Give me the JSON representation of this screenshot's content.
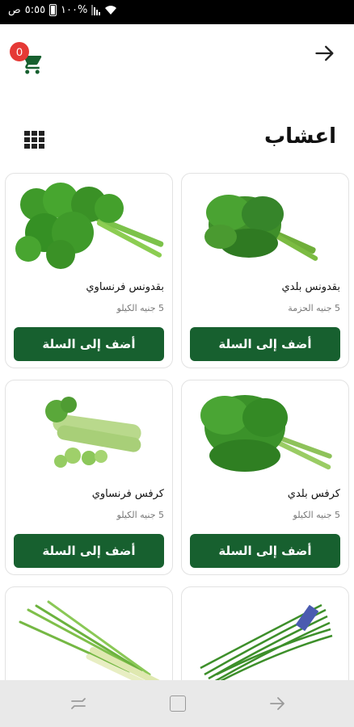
{
  "status_bar": {
    "time": "٥:٥٥",
    "period": "ص",
    "battery_text": "%١٠٠"
  },
  "cart": {
    "count": "0",
    "icon": "shopping-cart-icon"
  },
  "header": {
    "back_icon": "arrow-right-icon"
  },
  "section": {
    "title": "اعشاب",
    "view_toggle_icon": "grid-view-icon"
  },
  "products": [
    {
      "name": "بقدونس بلدي",
      "price": "5 جنيه الحزمة",
      "button": "أضف إلى السلة",
      "image": "parsley-bunch"
    },
    {
      "name": "بقدونس فرنساوي",
      "price": "5 جنيه الكيلو",
      "button": "أضف إلى السلة",
      "image": "curly-parsley"
    },
    {
      "name": "كرفس بلدي",
      "price": "5 جنيه الكيلو",
      "button": "أضف إلى السلة",
      "image": "celery-leaves"
    },
    {
      "name": "كرفس فرنساوي",
      "price": "5 جنيه الكيلو",
      "button": "أضف إلى السلة",
      "image": "celery-stalks"
    },
    {
      "name": "",
      "price": "",
      "button": "",
      "image": "chives-bunch"
    },
    {
      "name": "",
      "price": "",
      "button": "",
      "image": "lemongrass"
    }
  ],
  "colors": {
    "accent": "#17602f",
    "badge": "#e53935",
    "leaf": "#3f9a2a"
  },
  "nav_bar": {
    "icons": [
      "recents-icon",
      "home-icon",
      "back-icon"
    ]
  }
}
